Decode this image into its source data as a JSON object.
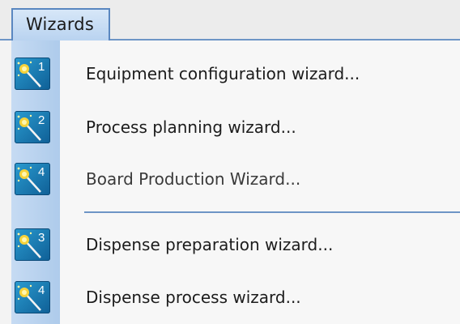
{
  "menu": {
    "title": "Wizards",
    "items": [
      {
        "label": "Equipment configuration wizard...",
        "badge": "1",
        "icon": "magic-wand-icon"
      },
      {
        "label": "Process planning wizard...",
        "badge": "2",
        "icon": "magic-wand-icon"
      },
      {
        "label": "Board Production Wizard...",
        "badge": "4",
        "icon": "magic-wand-icon"
      },
      {
        "label": "Dispense preparation wizard...",
        "badge": "3",
        "icon": "magic-wand-icon"
      },
      {
        "label": "Dispense process wizard...",
        "badge": "4",
        "icon": "magic-wand-icon"
      }
    ]
  },
  "colors": {
    "accent": "#6d95c6",
    "icon_background": "#1a7fb8",
    "icon_column": "#b9d3f0"
  }
}
